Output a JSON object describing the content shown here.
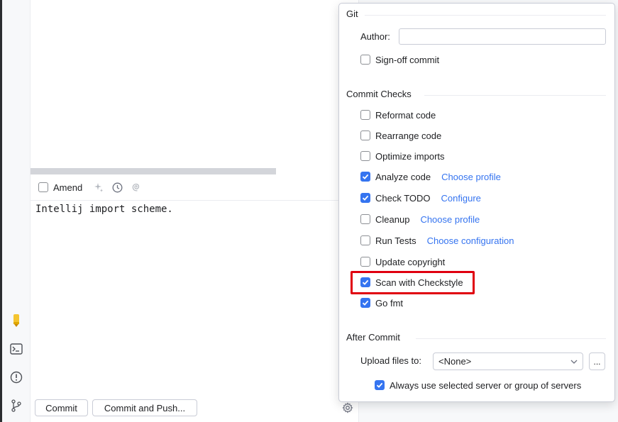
{
  "left_toolbar": {
    "icons": [
      "pencil-marker-icon",
      "terminal-icon",
      "problems-icon",
      "git-branch-icon"
    ]
  },
  "commit_panel": {
    "amend_label": "Amend",
    "amend_checked": false,
    "message": "Intellij import scheme.",
    "commit_button": "Commit",
    "commit_and_push_button": "Commit and Push..."
  },
  "popup": {
    "git_section": {
      "title": "Git",
      "author_label": "Author:",
      "author_value": "",
      "signoff_label": "Sign-off commit",
      "signoff_checked": false
    },
    "commit_checks": {
      "title": "Commit Checks",
      "items": [
        {
          "label": "Reformat code",
          "checked": false,
          "link": ""
        },
        {
          "label": "Rearrange code",
          "checked": false,
          "link": ""
        },
        {
          "label": "Optimize imports",
          "checked": false,
          "link": ""
        },
        {
          "label": "Analyze code",
          "checked": true,
          "link": "Choose profile"
        },
        {
          "label": "Check TODO",
          "checked": true,
          "link": "Configure"
        },
        {
          "label": "Cleanup",
          "checked": false,
          "link": "Choose profile"
        },
        {
          "label": "Run Tests",
          "checked": false,
          "link": "Choose configuration"
        },
        {
          "label": "Update copyright",
          "checked": false,
          "link": ""
        },
        {
          "label": "Scan with Checkstyle",
          "checked": true,
          "link": ""
        },
        {
          "label": "Go fmt",
          "checked": true,
          "link": ""
        }
      ],
      "highlighted_item": "Scan with Checkstyle",
      "highlight_color": "#e0000f"
    },
    "after_commit": {
      "title": "After Commit",
      "upload_label": "Upload files to:",
      "upload_value": "<None>",
      "more_button": "...",
      "always_use_label": "Always use selected server or group of servers",
      "always_use_checked": true
    }
  },
  "colors": {
    "accent": "#3574f0",
    "link": "#3574f0",
    "highlight": "#e0000f"
  }
}
